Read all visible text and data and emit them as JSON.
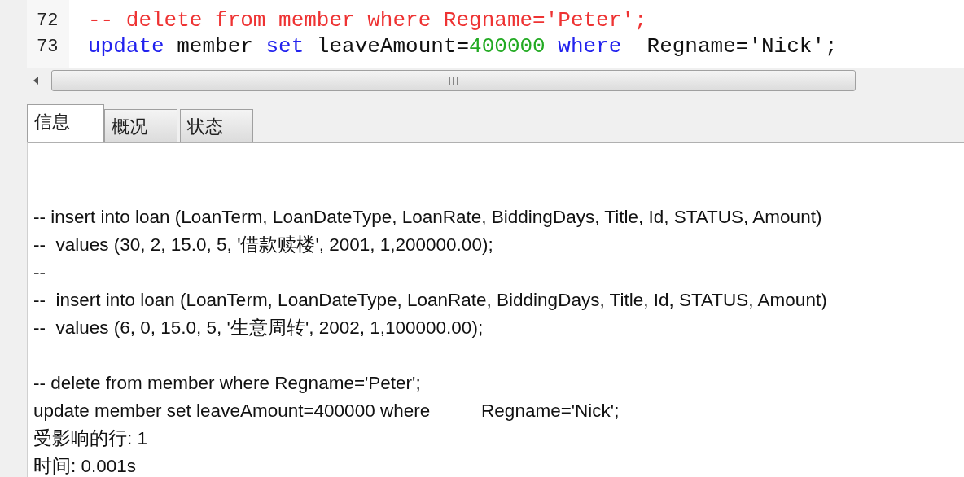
{
  "editor": {
    "lines": [
      {
        "number": "72",
        "tokens": [
          {
            "kind": "comment",
            "text": "-- delete from member where Regname='Peter';"
          }
        ]
      },
      {
        "number": "73",
        "tokens": [
          {
            "kind": "keyword",
            "text": "update"
          },
          {
            "kind": "plain",
            "text": " member "
          },
          {
            "kind": "keyword",
            "text": "set"
          },
          {
            "kind": "plain",
            "text": " leaveAmount="
          },
          {
            "kind": "number",
            "text": "400000"
          },
          {
            "kind": "keyword",
            "text": " where"
          },
          {
            "kind": "plain",
            "text": "  Regname='Nick';"
          }
        ]
      }
    ]
  },
  "tabs": [
    {
      "label": "信息",
      "selected": true
    },
    {
      "label": "概况",
      "selected": false
    },
    {
      "label": "状态",
      "selected": false
    }
  ],
  "output": {
    "lines": [
      {
        "kind": "text",
        "text": "-- insert into loan (LoanTerm, LoanDateType, LoanRate, BiddingDays, Title, Id, STATUS, Amount)"
      },
      {
        "kind": "text",
        "text": "--  values (30, 2, 15.0, 5, '借款赎楼', 2001, 1,200000.00);"
      },
      {
        "kind": "text",
        "text": "--"
      },
      {
        "kind": "text",
        "text": "--  insert into loan (LoanTerm, LoanDateType, LoanRate, BiddingDays, Title, Id, STATUS, Amount)"
      },
      {
        "kind": "text",
        "text": "--  values (6, 0, 15.0, 5, '生意周转', 2002, 1,100000.00);"
      },
      {
        "kind": "blank"
      },
      {
        "kind": "text",
        "text": "-- delete from member where Regname='Peter';"
      },
      {
        "kind": "text",
        "text": "update member set leaveAmount=400000 where\tRegname='Nick';"
      },
      {
        "kind": "text",
        "text": "受影响的行: 1"
      },
      {
        "kind": "text",
        "text": "时间: 0.001s"
      }
    ]
  }
}
